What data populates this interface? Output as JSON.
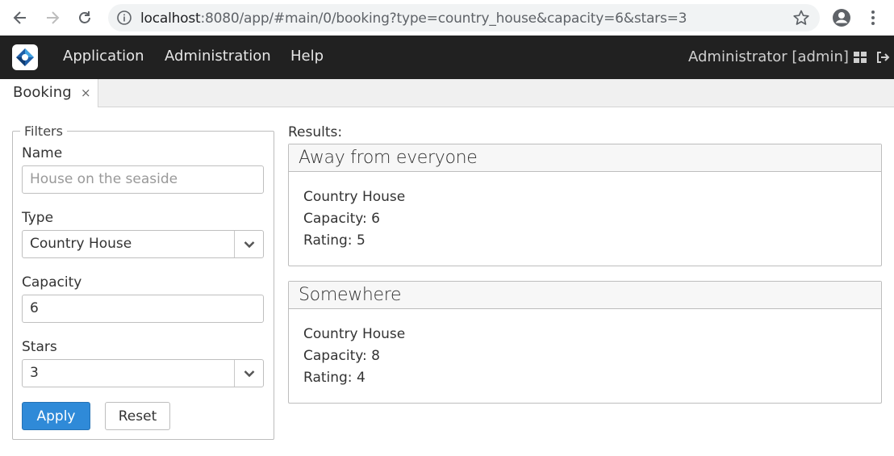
{
  "browser": {
    "url_host": "localhost",
    "url_rest": ":8080/app/#main/0/booking?type=country_house&capacity=6&stars=3"
  },
  "menubar": {
    "items": [
      {
        "label": "Application"
      },
      {
        "label": "Administration"
      },
      {
        "label": "Help"
      }
    ],
    "user": "Administrator [admin]"
  },
  "tabs": [
    {
      "label": "Booking",
      "close": "×"
    }
  ],
  "filters": {
    "legend": "Filters",
    "name": {
      "label": "Name",
      "placeholder": "House on the seaside",
      "value": ""
    },
    "type": {
      "label": "Type",
      "value": "Country House"
    },
    "capacity": {
      "label": "Capacity",
      "value": "6"
    },
    "stars": {
      "label": "Stars",
      "value": "3"
    },
    "apply_label": "Apply",
    "reset_label": "Reset"
  },
  "results": {
    "label": "Results:",
    "items": [
      {
        "title": "Away from everyone",
        "type": "Country House",
        "capacity": "Capacity: 6",
        "rating": "Rating: 5"
      },
      {
        "title": "Somewhere",
        "type": "Country House",
        "capacity": "Capacity: 8",
        "rating": "Rating: 4"
      }
    ]
  },
  "colors": {
    "menubar_bg": "#212121",
    "apply_bg": "#2f8ad8",
    "tabstrip_bg": "#f0f0f0"
  },
  "icons": {
    "back": "arrow-left-icon",
    "forward": "arrow-right-icon",
    "reload": "reload-icon",
    "info": "info-icon",
    "bookmark": "star-icon",
    "account": "account-icon",
    "menu": "kebab-icon",
    "logo": "app-logo",
    "windows": "windows-grid-icon",
    "logout": "logout-icon",
    "dropdown": "chevron-down-icon"
  }
}
